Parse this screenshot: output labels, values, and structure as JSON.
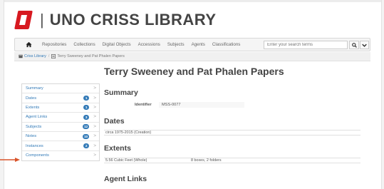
{
  "brand": {
    "title": "UNO CRISS LIBRARY",
    "separator": "|",
    "logo_icon": "uno-logo-icon",
    "logo_color": "#d71920"
  },
  "navbar": {
    "items": [
      "Repositories",
      "Collections",
      "Digital Objects",
      "Accessions",
      "Subjects",
      "Agents",
      "Classifications"
    ],
    "search_placeholder": "Enter your search terms"
  },
  "breadcrumb": {
    "items": [
      "Criss Library",
      "Terry Sweeney and Pat Phalen Papers"
    ]
  },
  "page": {
    "title": "Terry Sweeney and Pat Phalen Papers"
  },
  "sidebar": {
    "items": [
      {
        "label": "Summary",
        "badge": ""
      },
      {
        "label": "Dates",
        "badge": "1"
      },
      {
        "label": "Extents",
        "badge": "1"
      },
      {
        "label": "Agent Links",
        "badge": "3"
      },
      {
        "label": "Subjects",
        "badge": "12"
      },
      {
        "label": "Notes",
        "badge": "10"
      },
      {
        "label": "Instances",
        "badge": "2"
      },
      {
        "label": "Components",
        "badge": ""
      }
    ]
  },
  "summary": {
    "heading": "Summary",
    "identifier_label": "Identifier",
    "identifier_value": "MSS-0077"
  },
  "dates": {
    "heading": "Dates",
    "value": "circa 1975-2015 (Creation)"
  },
  "extents": {
    "heading": "Extents",
    "amount": "5.56 Cubic Feet (Whole)",
    "detail": "8 boxes, 2 folders"
  },
  "agent_links": {
    "heading": "Agent Links"
  },
  "colors": {
    "accent": "#337ab7",
    "logo_red": "#d71920",
    "arrow": "#d9542a"
  }
}
